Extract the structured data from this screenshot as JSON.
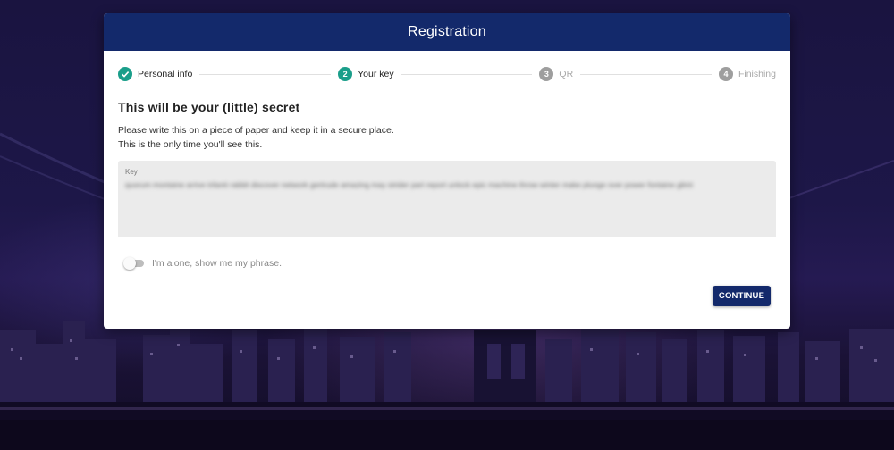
{
  "dialog": {
    "title": "Registration"
  },
  "stepper": {
    "steps": [
      {
        "number": "1",
        "label": "Personal info",
        "state": "done"
      },
      {
        "number": "2",
        "label": "Your key",
        "state": "active"
      },
      {
        "number": "3",
        "label": "QR",
        "state": "pending"
      },
      {
        "number": "4",
        "label": "Finishing",
        "state": "pending"
      }
    ]
  },
  "secret": {
    "headline": "This will be your (little) secret",
    "description_line1": "Please write this on a piece of paper and keep it in a secure place.",
    "description_line2": "This is the only time you'll see this.",
    "key_label": "Key",
    "key_value": "quorum montaine arrive trilanti rabbit discover network gertrude amazing may strider part report unlock epic machine throw winter make plunge over power fontaine glimt"
  },
  "toggle": {
    "label": "I'm alone, show me my phrase.",
    "checked": false
  },
  "actions": {
    "continue_label": "CONTINUE"
  },
  "colors": {
    "header": "#13296b",
    "step_active": "#1a9e8a",
    "step_pending": "#9e9e9e",
    "button": "#13296b"
  }
}
